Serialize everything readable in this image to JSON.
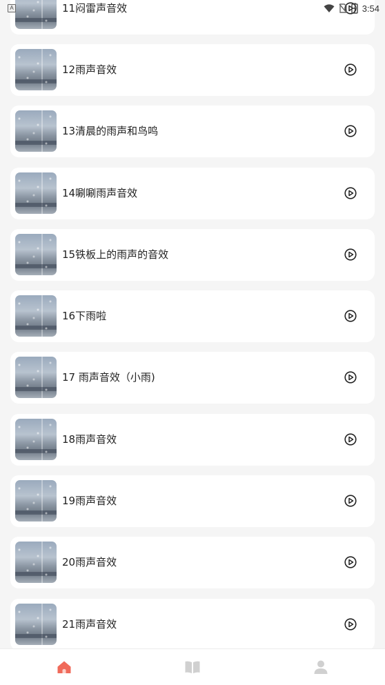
{
  "status_bar": {
    "notification_icon": "A",
    "time": "3:54",
    "icons": [
      "wifi-icon",
      "no-sim-icon",
      "battery-charging-icon"
    ]
  },
  "tracks": [
    {
      "title": "11闷雷声音效"
    },
    {
      "title": "12雨声音效"
    },
    {
      "title": "13清晨的雨声和鸟鸣"
    },
    {
      "title": "14唰唰雨声音效"
    },
    {
      "title": "15铁板上的雨声的音效"
    },
    {
      "title": "16下雨啦"
    },
    {
      "title": "17 雨声音效（小雨)"
    },
    {
      "title": "18雨声音效"
    },
    {
      "title": "19雨声音效"
    },
    {
      "title": "20雨声音效"
    },
    {
      "title": "21雨声音效"
    }
  ],
  "bottom_nav": {
    "items": [
      {
        "icon": "home-icon",
        "active": true
      },
      {
        "icon": "book-icon",
        "active": false
      },
      {
        "icon": "profile-icon",
        "active": false
      }
    ],
    "active_color": "#f06a5a",
    "inactive_color": "#d0d0d0"
  }
}
